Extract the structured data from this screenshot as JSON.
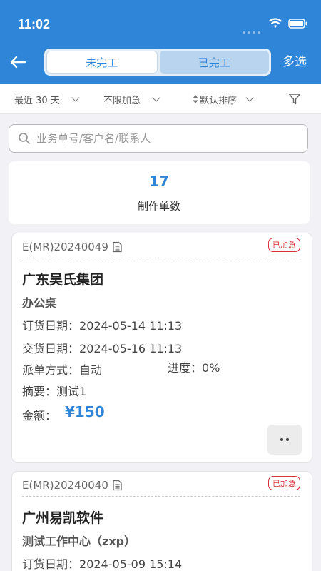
{
  "status_bar": {
    "time": "11:02"
  },
  "header": {
    "tabs": [
      {
        "label": "未完工",
        "active": true
      },
      {
        "label": "已完工",
        "active": false
      }
    ],
    "multi_select": "多选"
  },
  "filters": [
    {
      "label": "最近 30 天",
      "icon": "chevron-down-icon"
    },
    {
      "label": "不限加急",
      "icon": "chevron-down-icon"
    },
    {
      "label": "默认排序",
      "icon": "sort-icon"
    }
  ],
  "search": {
    "placeholder": "业务单号/客户名/联系人",
    "value": ""
  },
  "summary": {
    "count": "17",
    "label": "制作单数"
  },
  "orders": [
    {
      "order_no": "E(MR)20240049",
      "badge": "已加急",
      "customer": "广东吴氏集团",
      "product": "办公桌",
      "order_date_label": "订货日期：",
      "order_date": "2024-05-14 11:13",
      "delivery_date_label": "交货日期：",
      "delivery_date": "2024-05-16 11:13",
      "dispatch_label": "派单方式：",
      "dispatch": "自动",
      "progress_label": "进度：",
      "progress": "0%",
      "summary_label": "摘要：",
      "summary": "测试1",
      "amount_label": "金额：",
      "amount": "¥150"
    },
    {
      "order_no": "E(MR)20240040",
      "badge": "已加急",
      "customer": "广州易凯软件",
      "product": "测试工作中心（zxp）",
      "order_date_label": "订货日期：",
      "order_date": "2024-05-09 15:14"
    }
  ],
  "colors": {
    "primary": "#2f86d8",
    "urgent": "#d9303b",
    "background": "#f2f2f6"
  }
}
